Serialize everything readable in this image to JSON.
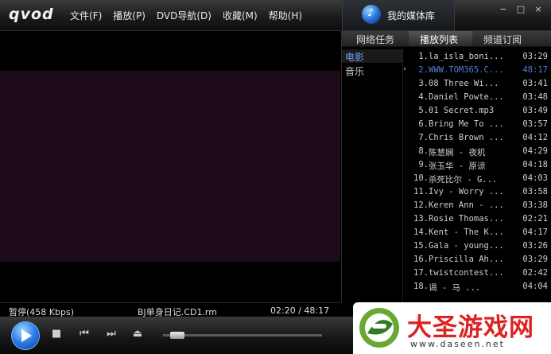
{
  "app": {
    "logo": "qvod"
  },
  "menu": [
    {
      "label": "文件(F)"
    },
    {
      "label": "播放(P)"
    },
    {
      "label": "DVD导航(D)"
    },
    {
      "label": "收藏(M)"
    },
    {
      "label": "帮助(H)"
    }
  ],
  "media_tab": {
    "label": "我的媒体库"
  },
  "window_buttons": [
    "−",
    "□",
    "×"
  ],
  "panel": {
    "tabs": [
      "网络任务",
      "播放列表",
      "频道订阅"
    ],
    "active_tab": "播放列表",
    "categories": [
      "电影",
      "音乐"
    ],
    "selected_category": "电影"
  },
  "playlist": [
    {
      "num": "1.",
      "title": "la_isla_boni...",
      "dur": "03:29"
    },
    {
      "num": "2.",
      "title": "WWW.TOM365.C...",
      "dur": "48:17",
      "current": true
    },
    {
      "num": "3.",
      "title": "08  Three Wi...",
      "dur": "03:41"
    },
    {
      "num": "4.",
      "title": "Daniel Powte...",
      "dur": "03:48"
    },
    {
      "num": "5.",
      "title": "01  Secret.mp3",
      "dur": "03:49"
    },
    {
      "num": "6.",
      "title": "Bring Me To ...",
      "dur": "03:57"
    },
    {
      "num": "7.",
      "title": "Chris Brown ...",
      "dur": "04:12"
    },
    {
      "num": "8.",
      "title": "陈慧娴 - 夜机",
      "dur": "04:29"
    },
    {
      "num": "9.",
      "title": "张玉华 - 原谅",
      "dur": "04:18"
    },
    {
      "num": "10.",
      "title": "杀死比尔 - G...",
      "dur": "04:03"
    },
    {
      "num": "11.",
      "title": "Ivy - Worry ...",
      "dur": "03:58"
    },
    {
      "num": "12.",
      "title": "Keren Ann - ...",
      "dur": "03:38"
    },
    {
      "num": "13.",
      "title": "Rosie Thomas...",
      "dur": "02:21"
    },
    {
      "num": "14.",
      "title": "Kent - The K...",
      "dur": "04:17"
    },
    {
      "num": "15.",
      "title": "Gala - young...",
      "dur": "03:26"
    },
    {
      "num": "16.",
      "title": "Priscilla Ah...",
      "dur": "03:29"
    },
    {
      "num": "17.",
      "title": "twistcontest...",
      "dur": "02:42"
    },
    {
      "num": "18.",
      "title": "谒 - 马    ...",
      "dur": "04:04"
    }
  ],
  "status": {
    "state": "暂停(458 Kbps)",
    "file": "BJ单身日记.CD1.rm",
    "time": "02:20 / 48:17"
  },
  "controls": {
    "volume_level": 0.05
  },
  "watermark": {
    "title": "大圣游戏网",
    "url": "www.daseen.net"
  },
  "colors": {
    "current_track": "#4f7cd8",
    "selected_category": "#6fa6ff",
    "brand_red": "#dd2222"
  }
}
